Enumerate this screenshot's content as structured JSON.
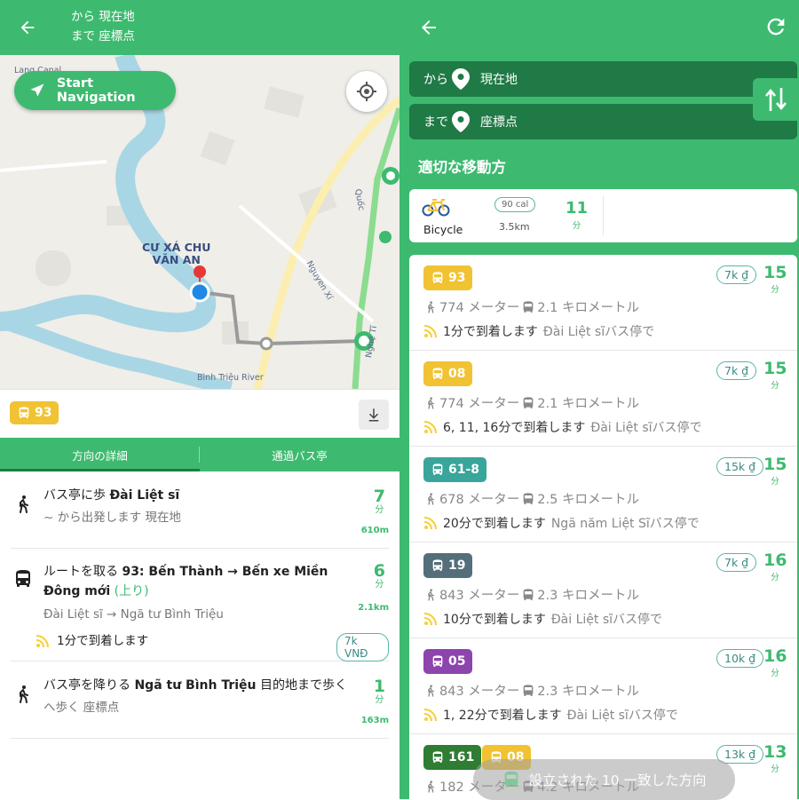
{
  "left": {
    "header": {
      "from_line": "から 現在地",
      "to_line": "まで 座標点"
    },
    "map": {
      "start_navigation": "Start Navigation",
      "district_label_1": "CƯ XÁ CHU",
      "district_label_2": "VĂN AN",
      "street_nguyen": "Nguyen Xí",
      "river_label": "Bình Triệu River",
      "road_quoc": "Quốc",
      "road_nghe": "Nghệ Tĩ",
      "canal_label": "Lang Canal"
    },
    "bus_bar": {
      "route": "93"
    },
    "tabs": [
      {
        "label": "方向の詳細"
      },
      {
        "label": "通過バス亭"
      }
    ],
    "steps": [
      {
        "pre": "バス亭に歩 ",
        "bold": "Đài Liệt sĩ",
        "sub": "~ から出発します 現在地",
        "minutes": "7",
        "unit": "分",
        "distance": "610m"
      },
      {
        "pre": "ルートを取る ",
        "bold": "93: Bến Thành → Bến xe Miền Đông mới",
        "suffix": " (上り)",
        "sub": "Đài Liệt sĩ  →  Ngã tư Bình Triệu",
        "arrival": "1分で到着します",
        "price": "7k VNĐ",
        "minutes": "6",
        "unit": "分",
        "distance": "2.1km"
      },
      {
        "pre": "バス亭を降りる ",
        "bold": "Ngã tư Bình Triệu",
        "suffix": " 目的地まで歩く",
        "sub": "へ歩く 座標点",
        "minutes": "1",
        "unit": "分",
        "distance": "163m"
      }
    ]
  },
  "right": {
    "from": {
      "label": "から",
      "value": "現在地"
    },
    "to": {
      "label": "まで",
      "value": "座標点"
    },
    "section_title": "適切な移動方",
    "bicycle": {
      "label": "Bicycle",
      "cal": "90 cal",
      "distance": "3.5km",
      "minutes": "11",
      "unit": "分"
    },
    "routes": [
      {
        "badge": "93",
        "color": "#f1c232",
        "price": "7k ₫",
        "minutes": "15",
        "unit": "分",
        "walk": "774 メーター",
        "ride": "2.1 キロメートル",
        "arrival": "1分で到着します",
        "stop": "Đài Liệt sĩバス停で"
      },
      {
        "badge": "08",
        "color": "#f1c232",
        "price": "7k ₫",
        "minutes": "15",
        "unit": "分",
        "walk": "774 メーター",
        "ride": "2.1 キロメートル",
        "arrival": "6, 11, 16分で到着します",
        "stop": "Đài Liệt sĩバス停で"
      },
      {
        "badge": "61-8",
        "color": "#3aa59a",
        "price": "15k ₫",
        "minutes": "15",
        "unit": "分",
        "walk": "678 メーター",
        "ride": "2.5 キロメートル",
        "arrival": "20分で到着します",
        "stop": "Ngã năm Liệt Sĩバス停で"
      },
      {
        "badge": "19",
        "color": "#546e7a",
        "price": "7k ₫",
        "minutes": "16",
        "unit": "分",
        "walk": "843 メーター",
        "ride": "2.3 キロメートル",
        "arrival": "10分で到着します",
        "stop": "Đài Liệt sĩバス停で"
      },
      {
        "badge": "05",
        "color": "#8e44ad",
        "price": "10k ₫",
        "minutes": "16",
        "unit": "分",
        "walk": "843 メーター",
        "ride": "2.3 キロメートル",
        "arrival": "1, 22分で到着します",
        "stop": "Đài Liệt sĩバス停で"
      },
      {
        "badge": "161",
        "badge2": "08",
        "color": "#2e7d32",
        "color2": "#f1c232",
        "price": "13k ₫",
        "minutes": "13",
        "unit": "分",
        "walk": "182 メーター",
        "ride": "4.2 キロメートル"
      }
    ],
    "toast": "設立された 10 一致した方向"
  },
  "colors": {
    "brand_green": "#3dba6f",
    "dark_green": "#1f7a46",
    "bus_yellow": "#f1c232"
  }
}
